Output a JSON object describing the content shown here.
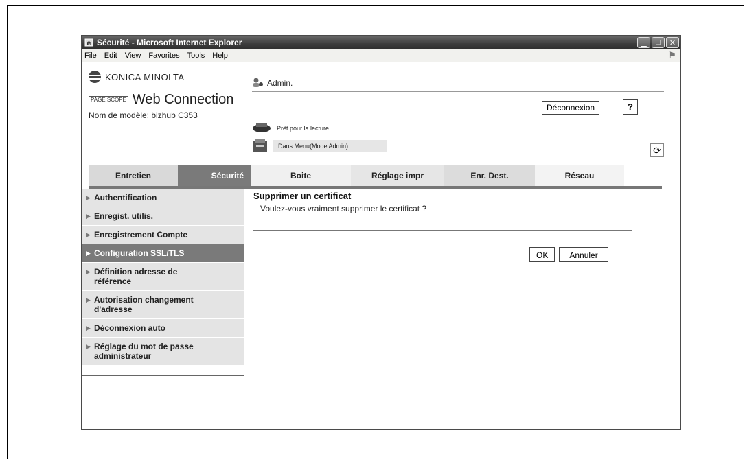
{
  "window": {
    "title": "Sécurité - Microsoft Internet Explorer",
    "controls": [
      "_",
      "□",
      "X"
    ]
  },
  "menubar": {
    "items": [
      "File",
      "Edit",
      "View",
      "Favorites",
      "Tools",
      "Help"
    ]
  },
  "header": {
    "brand": "KONICA MINOLTA",
    "product_logo_text": "PAGE SCOPE",
    "product_name": "Web Connection",
    "model": "Nom de modèle: bizhub C353",
    "user": "Admin.",
    "logout_label": "Déconnexion",
    "help_label": "?",
    "status_ready": "Prêt pour la lecture",
    "status_menu": "Dans Menu(Mode Admin)"
  },
  "tabs": [
    {
      "label": "Entretien",
      "active": false
    },
    {
      "label": "Sécurité",
      "active": true
    },
    {
      "label": "Boite",
      "active": false
    },
    {
      "label": "Réglage impr",
      "active": false
    },
    {
      "label": "Enr. Dest.",
      "active": false
    },
    {
      "label": "Réseau",
      "active": false
    }
  ],
  "sidebar": {
    "items": [
      {
        "label": "Authentification",
        "active": false
      },
      {
        "label": "Enregist. utilis.",
        "active": false
      },
      {
        "label": "Enregistrement Compte",
        "active": false
      },
      {
        "label": "Configuration SSL/TLS",
        "active": true
      },
      {
        "label": "Définition adresse de référence",
        "active": false
      },
      {
        "label": "Autorisation changement d'adresse",
        "active": false
      },
      {
        "label": "Déconnexion auto",
        "active": false
      },
      {
        "label": "Réglage du mot de passe administrateur",
        "active": false
      }
    ]
  },
  "main": {
    "title": "Supprimer un certificat",
    "question": "Voulez-vous vraiment supprimer le certificat ?",
    "ok_label": "OK",
    "cancel_label": "Annuler"
  }
}
